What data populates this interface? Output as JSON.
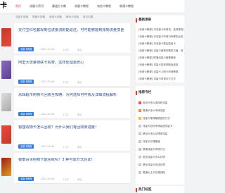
{
  "header": {
    "logo": "卡",
    "logo_sub": "",
    "nav": [
      "首页",
      "流量卡资讯",
      "渠道方卡教",
      "流量卡教程",
      "电信卡教程",
      "联通卡教程"
    ]
  },
  "breadcrumb": [
    "流量卡攻略",
    "联通卡攻略",
    "电信卡攻略",
    "移动卡攻略",
    "常见问题"
  ],
  "articles": [
    {
      "title": "支付宝红包套现到位流量流限能退还，可可能够能到账到流量变更",
      "tag": "流量卡教程",
      "date": "2024-05-08",
      "views": "1.6万",
      "comments": "评论"
    },
    {
      "title": "阿里大流量物联卡劣势，这样处理更安心",
      "tag": "流量卡教程",
      "date": "2024-05-08",
      "views": "1.3万",
      "comments": "评论"
    },
    {
      "title": "永辉超市购物卡回收全攻略：为何选择可可收及详细流程解析",
      "tag": "流量卡教程",
      "date": "2024-05-08",
      "views": "1.2万",
      "comments": "评论"
    },
    {
      "title": "银座购物卡怎么回收？为什么我们有回收卖进度！",
      "tag": "流量卡教程",
      "date": "2024-05-08",
      "views": "1.1万",
      "comments": "评论"
    },
    {
      "title": "银泰百货购物卡能回收吗？3 种可靠方式在此！",
      "tag": "流量卡教程",
      "date": "2024-05-08",
      "views": "1.0万",
      "comments": "评论"
    }
  ],
  "sidebar": {
    "latest_title": "最新更新",
    "latest": [
      "[电商卡教程] 可流量卡申请流，连转是真的吗",
      "[电商卡教程] 可流量卡申请为有哪些比较",
      "[电商卡教程] 可流量卡是否能给卡",
      "[电商卡教程] 流量卡推荐的哪些方面，效",
      "[电商卡教程] 联通流量卡套餐推荐",
      "[电商卡教程] 流量卡如何领取免费选",
      "[电商卡教程] 流量卡上网卡申请教程",
      "[电商卡教程] 流量卡申请办卡方式"
    ],
    "rank_title": "推荐专栏",
    "rank": [
      "电信卡怎么选择到流量",
      "联通卡怎么申请流量",
      "流量卡推荐最便宜的方式",
      "流量卡如何申请高速流量卡",
      "移动卡怎么办理送流量",
      "流量卡办理渠道",
      "联通流量卡申请方法",
      "电信流量卡怎么办理",
      "移动流量卡在线办理",
      "联通大王卡办理流程"
    ],
    "hot_title": "热门标签"
  },
  "colors": {
    "accent": "#e33333",
    "link": "#2a4e8a",
    "tag": "#3a7bd5"
  }
}
